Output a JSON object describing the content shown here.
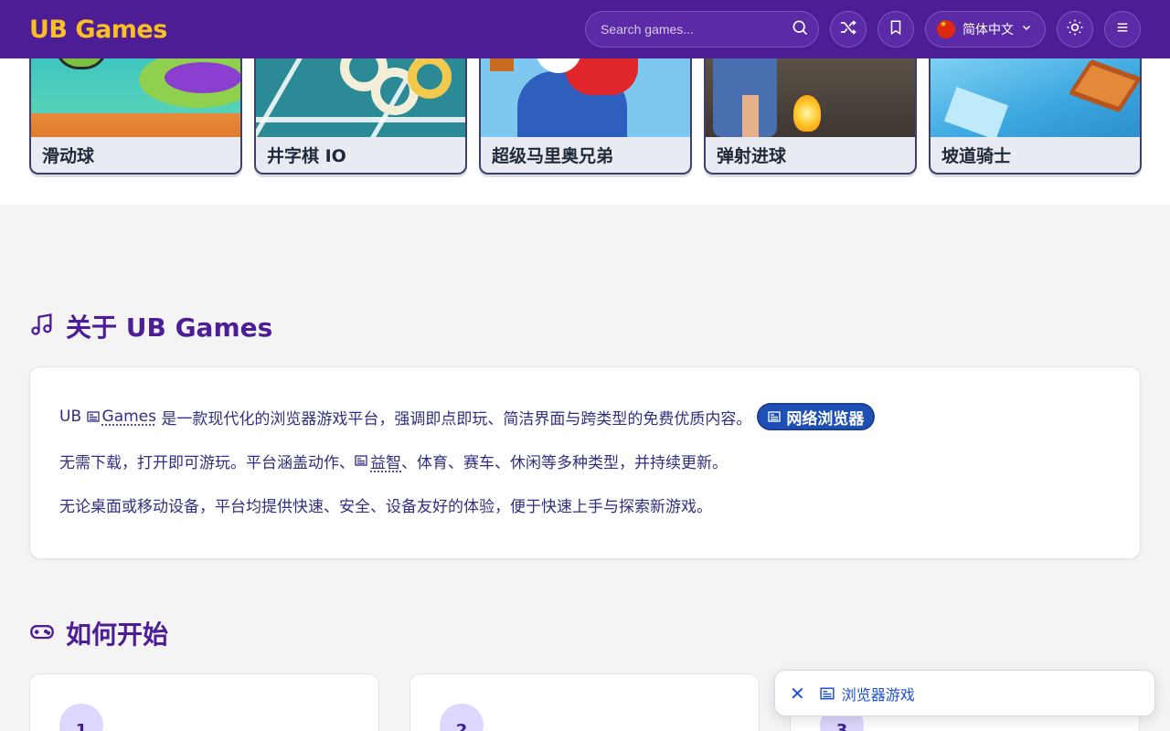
{
  "header": {
    "logo": "UB Games",
    "search_placeholder": "Search games...",
    "language_label": "简体中文"
  },
  "games": [
    {
      "title": "滑动球"
    },
    {
      "title": "井字棋 IO"
    },
    {
      "title": "超级马里奥兄弟"
    },
    {
      "title": "弹射进球"
    },
    {
      "title": "坡道骑士"
    }
  ],
  "about": {
    "heading": "关于 UB Games",
    "p1_prefix": "UB",
    "p1_link": "Games",
    "p1_text": "是一款现代化的浏览器游戏平台，强调即点即玩、简洁界面与跨类型的免费优质内容。",
    "p1_pill": "网络浏览器",
    "p2_before": "无需下载，打开即可游玩。平台涵盖动作、",
    "p2_link": "益智",
    "p2_after": "、体育、赛车、休闲等多种类型，并持续更新。",
    "p3": "无论桌面或移动设备，平台均提供快速、安全、设备友好的体验，便于快速上手与探索新游戏。"
  },
  "start": {
    "heading": "如何开始",
    "steps": [
      "1",
      "2",
      "3"
    ]
  },
  "toast": {
    "label": "浏览器游戏"
  }
}
